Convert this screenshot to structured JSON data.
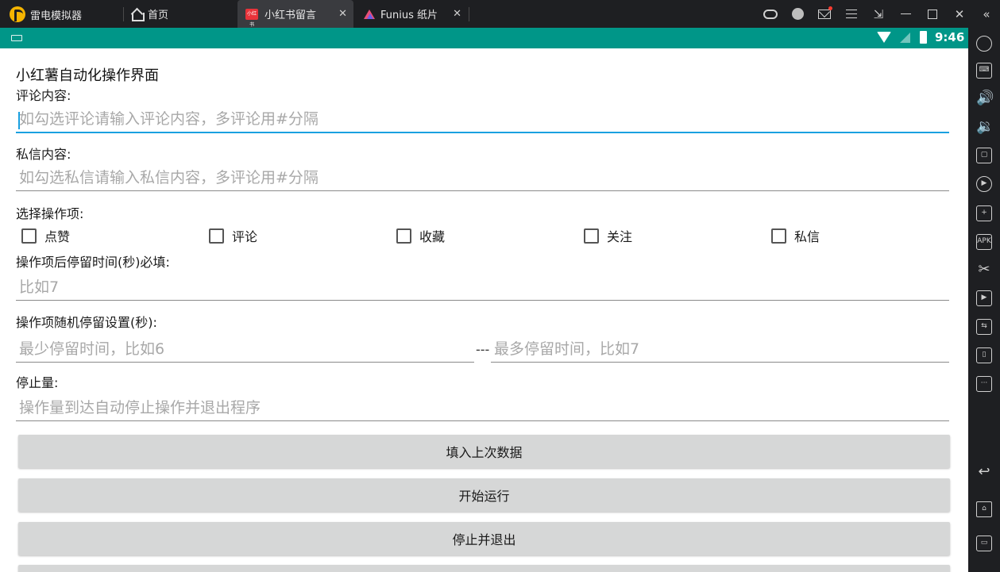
{
  "titlebar": {
    "app_name": "雷电模拟器",
    "tabs": [
      {
        "label": "首页"
      },
      {
        "label": "小红书留言",
        "icon_text": "小红书"
      },
      {
        "label": "Funius 纸片"
      }
    ],
    "close_glyph": "✕"
  },
  "statusbar": {
    "time": "9:46"
  },
  "form": {
    "title": "小红薯自动化操作界面",
    "comment_label": "评论内容:",
    "comment_placeholder": "如勾选评论请输入评论内容，多评论用#分隔",
    "pm_label": "私信内容:",
    "pm_placeholder": "如勾选私信请输入私信内容，多评论用#分隔",
    "ops_label": "选择操作项:",
    "ops": [
      "点赞",
      "评论",
      "收藏",
      "关注",
      "私信"
    ],
    "stay_label": "操作项后停留时间(秒)必填:",
    "stay_placeholder": "比如7",
    "random_label": "操作项随机停留设置(秒):",
    "random_min_placeholder": "最少停留时间，比如6",
    "random_sep": "---",
    "random_max_placeholder": "最多停留时间，比如7",
    "stop_label": "停止量:",
    "stop_placeholder": "操作量到达自动停止操作并退出程序"
  },
  "buttons": {
    "fill_last": "填入上次数据",
    "start": "开始运行",
    "stop_exit": "停止并退出"
  },
  "colors": {
    "status_bar": "#009688",
    "focus_line": "#1aa0e0",
    "button_bg": "#d6d7d7"
  }
}
